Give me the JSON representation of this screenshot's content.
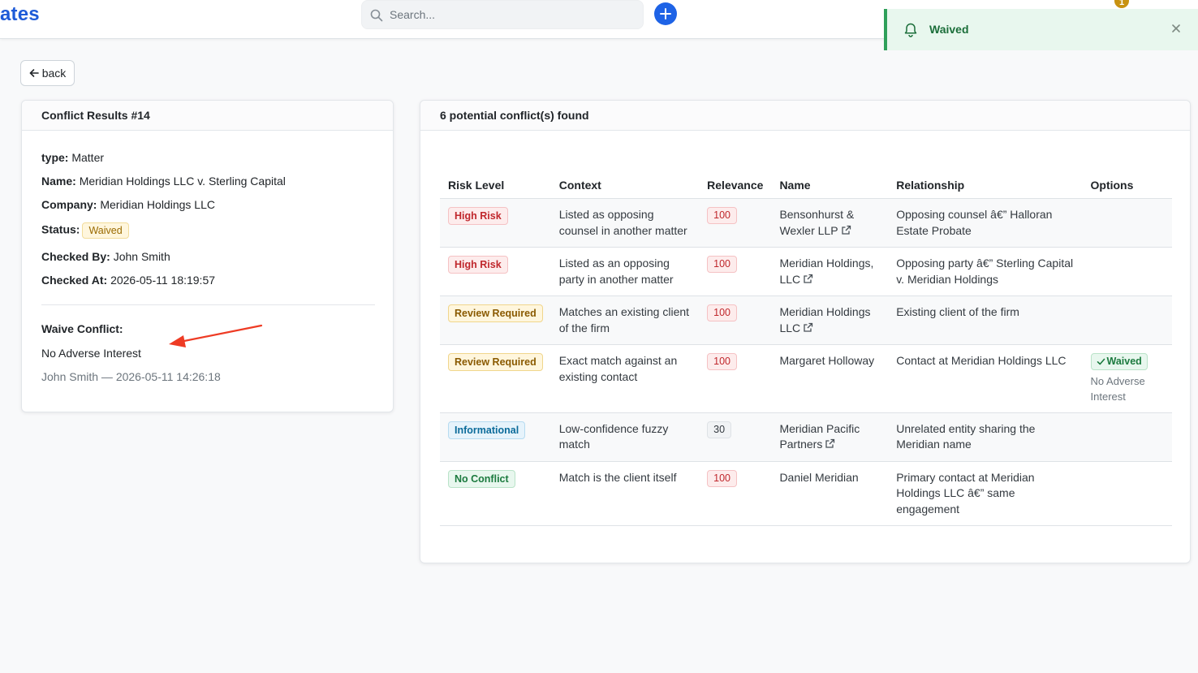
{
  "app": {
    "brand": "ates"
  },
  "search": {
    "placeholder": "Search..."
  },
  "notifications": {
    "count": "1"
  },
  "toast": {
    "message": "Waived"
  },
  "back": {
    "label": "back"
  },
  "summary": {
    "title": "Conflict Results #14",
    "type_label": "type:",
    "type_value": "Matter",
    "name_label": "Name:",
    "name_value": "Meridian Holdings LLC v. Sterling Capital",
    "company_label": "Company:",
    "company_value": "Meridian Holdings LLC",
    "status_label": "Status:",
    "status_value": "Waived",
    "checked_by_label": "Checked By:",
    "checked_by_value": "John Smith",
    "checked_at_label": "Checked At:",
    "checked_at_value": "2026-05-11 18:19:57",
    "waive_label": "Waive Conflict:",
    "waive_reason": "No Adverse Interest",
    "waive_meta": "John Smith — 2026-05-11 14:26:18"
  },
  "results": {
    "title": "6 potential conflict(s) found",
    "columns": [
      "Risk Level",
      "Context",
      "Relevance",
      "Name",
      "Relationship",
      "Options"
    ],
    "rows": [
      {
        "risk": "High Risk",
        "context": "Listed as opposing counsel in another matter",
        "relevance": "100",
        "name": "Bensonhurst & Wexler LLP",
        "relationship": "Opposing counsel â€” Halloran Estate Probate",
        "option": "",
        "option_note": ""
      },
      {
        "risk": "High Risk",
        "context": "Listed as an opposing party in another matter",
        "relevance": "100",
        "name": "Meridian Holdings, LLC",
        "relationship": "Opposing party â€” Sterling Capital v. Meridian Holdings",
        "option": "",
        "option_note": ""
      },
      {
        "risk": "Review Required",
        "context": "Matches an existing client of the firm",
        "relevance": "100",
        "name": "Meridian Holdings LLC",
        "relationship": "Existing client of the firm",
        "option": "",
        "option_note": ""
      },
      {
        "risk": "Review Required",
        "context": "Exact match against an existing contact",
        "relevance": "100",
        "name": "Margaret Holloway",
        "relationship": "Contact at Meridian Holdings LLC",
        "option": "Waived",
        "option_note": "No Adverse Interest"
      },
      {
        "risk": "Informational",
        "context": "Low-confidence fuzzy match",
        "relevance": "30",
        "name": "Meridian Pacific Partners",
        "relationship": "Unrelated entity sharing the Meridian name",
        "option": "",
        "option_note": ""
      },
      {
        "risk": "No Conflict",
        "context": "Match is the client itself",
        "relevance": "100",
        "name": "Daniel Meridian",
        "relationship": "Primary contact at Meridian Holdings LLC â€” same engagement",
        "option": "",
        "option_note": ""
      }
    ]
  },
  "colors": {
    "brand": "#1e5bd8",
    "high": "#c0282d",
    "review": "#8a5a00",
    "info": "#0b6b9a",
    "ok": "#1b7a3e",
    "annotation": "#ee3b24"
  }
}
